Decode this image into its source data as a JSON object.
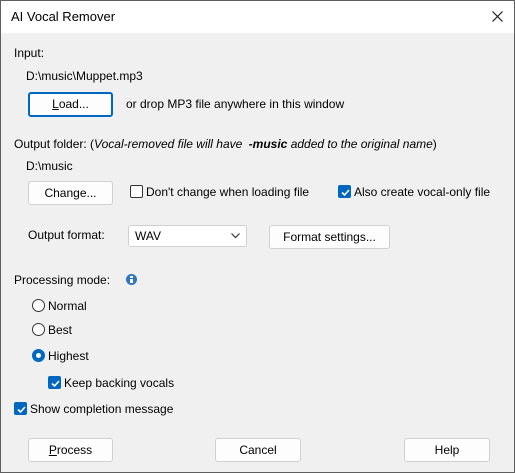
{
  "window": {
    "title": "AI Vocal Remover"
  },
  "input": {
    "label": "Input:",
    "path": "D:\\music\\Muppet.mp3",
    "load_button": "Load...",
    "drop_hint": "or drop MP3 file anywhere in this window"
  },
  "output": {
    "label_prefix": "Output folder: (",
    "note_part1": "Vocal-removed file will have ",
    "note_bold": "-music",
    "note_part2": " added to the original name",
    "label_suffix": ")",
    "path": "D:\\music",
    "change_button": "Change...",
    "dont_change_label": "Don't change when loading file",
    "dont_change_checked": false,
    "vocal_only_label": "Also create vocal-only file",
    "vocal_only_checked": true
  },
  "format": {
    "label": "Output format:",
    "selected": "WAV",
    "settings_button": "Format settings..."
  },
  "processing": {
    "label": "Processing mode:",
    "options": [
      {
        "label": "Normal",
        "selected": false
      },
      {
        "label": "Best",
        "selected": false
      },
      {
        "label": "Highest",
        "selected": true
      }
    ],
    "keep_backing_label": "Keep backing vocals",
    "keep_backing_checked": true
  },
  "completion": {
    "label": "Show completion message",
    "checked": true
  },
  "buttons": {
    "process": "Process",
    "cancel": "Cancel",
    "help": "Help"
  },
  "colors": {
    "accent": "#0067c0",
    "background": "#f0f0f0"
  }
}
